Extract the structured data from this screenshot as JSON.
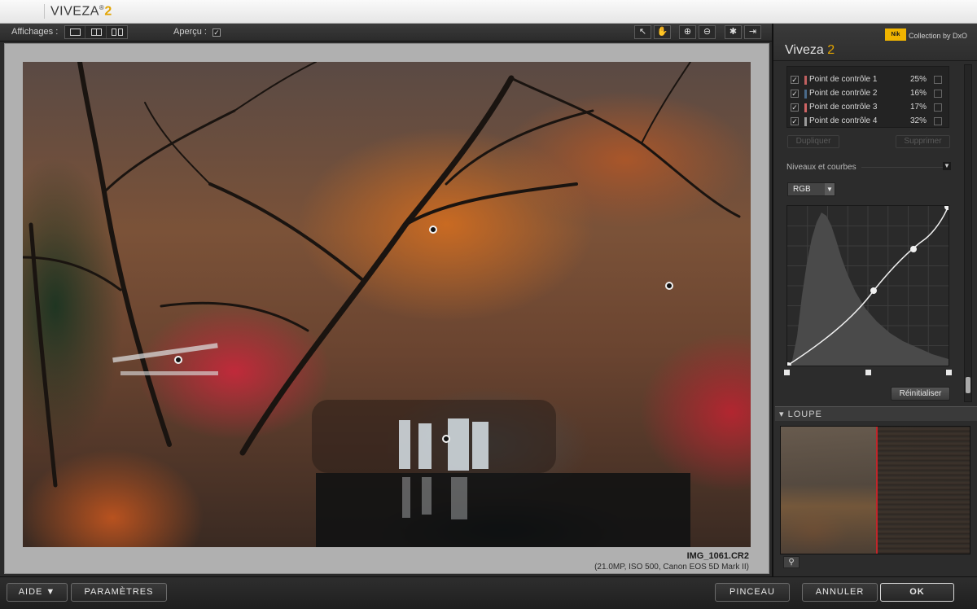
{
  "window": {
    "app_name": "VIVEZA",
    "app_mark": "®",
    "app_version": "2"
  },
  "toolbar": {
    "affichages_label": "Affichages :",
    "apercu_label": "Aperçu :",
    "apercu_checked": "✓",
    "tools": [
      {
        "name": "select-icon",
        "glyph": "↖"
      },
      {
        "name": "hand-icon",
        "glyph": "✋"
      },
      {
        "name": "zoom-in-icon",
        "glyph": "⊕"
      },
      {
        "name": "zoom-out-icon",
        "glyph": "⊖"
      },
      {
        "name": "lightbulb-icon",
        "glyph": "✱"
      },
      {
        "name": "export-icon",
        "glyph": "⇥"
      }
    ]
  },
  "image": {
    "file_name": "IMG_1061.CR2",
    "file_info": "(21.0MP, ISO 500, Canon EOS 5D Mark II)"
  },
  "panel": {
    "brand_logo": "Nik",
    "collection": "Collection by DxO",
    "title_name": "Viveza",
    "title_version": "2",
    "control_points": [
      {
        "label": "Point de contrôle 1",
        "percent": "25%",
        "swatch": "#c06060"
      },
      {
        "label": "Point de contrôle 2",
        "percent": "16%",
        "swatch": "#4a6a8a"
      },
      {
        "label": "Point de contrôle 3",
        "percent": "17%",
        "swatch": "#d06464"
      },
      {
        "label": "Point de contrôle 4",
        "percent": "32%",
        "swatch": "#9a9a9a"
      }
    ],
    "duplicate_label": "Dupliquer",
    "delete_label": "Supprimer",
    "levels_title": "Niveaux et courbes",
    "channel": "RGB",
    "reset_label": "Réinitialiser",
    "loupe_title": "LOUPE"
  },
  "bottom": {
    "aide": "AIDE ▼",
    "parametres": "PARAMÈTRES",
    "pinceau": "PINCEAU",
    "annuler": "ANNULER",
    "ok": "OK"
  },
  "colors": {
    "accent": "#e2a400",
    "loupe_divider": "#c0262a"
  }
}
